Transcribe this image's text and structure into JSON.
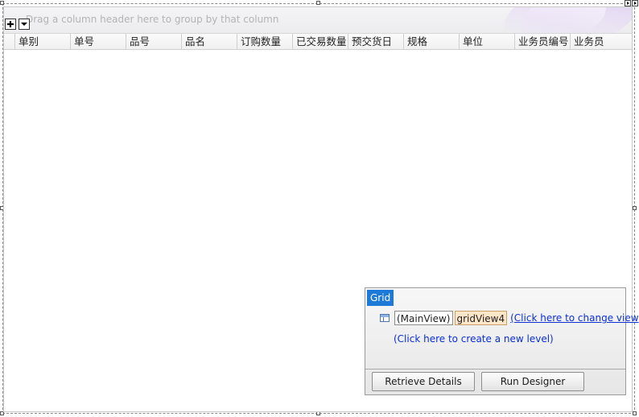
{
  "grid": {
    "group_panel_hint": "Drag a column header here to group by that column",
    "columns": [
      "单别",
      "单号",
      "品号",
      "品名",
      "订购数量",
      "已交易数量",
      "预交货日",
      "规格",
      "单位",
      "业务员编号",
      "业务员"
    ]
  },
  "designer": {
    "tag": "Grid",
    "main_view": "(MainView)",
    "view_name": "gridView4",
    "change_view_link": "(Click here to change view)",
    "new_level_link": "(Click here to create a new level)",
    "retrieve_button": "Retrieve Details",
    "run_button": "Run Designer"
  }
}
